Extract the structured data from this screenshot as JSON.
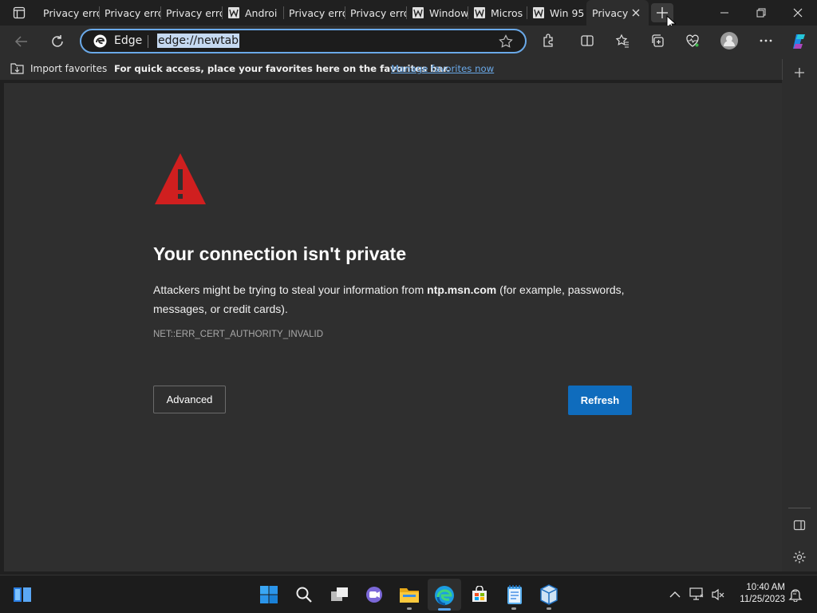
{
  "tabs": [
    {
      "label": "Privacy error",
      "icon": "page-icon"
    },
    {
      "label": "Privacy error",
      "icon": "page-icon"
    },
    {
      "label": "Privacy error",
      "icon": "page-icon"
    },
    {
      "label": "Androi",
      "icon": "wikipedia-icon"
    },
    {
      "label": "Privacy erro",
      "icon": "page-icon"
    },
    {
      "label": "Privacy erro",
      "icon": "page-icon"
    },
    {
      "label": "Window",
      "icon": "wikipedia-icon"
    },
    {
      "label": "Micros",
      "icon": "wikipedia-icon"
    },
    {
      "label": "Win 95",
      "icon": "wikipedia-icon"
    },
    {
      "label": "Privacy",
      "icon": "page-icon",
      "active": true
    }
  ],
  "address": {
    "brand": "Edge",
    "url": "edge://newtab"
  },
  "favorites_bar": {
    "import": "Import favorites",
    "message": "For quick access, place your favorites here on the favorites bar.",
    "manage_link": "Manage favorites now"
  },
  "error_page": {
    "heading": "Your connection isn't private",
    "body_prefix": "Attackers might be trying to steal your information from ",
    "host": "ntp.msn.com",
    "body_suffix": " (for example, passwords,",
    "body_line2": "messages, or credit cards).",
    "error_code": "NET::ERR_CERT_AUTHORITY_INVALID",
    "advanced_label": "Advanced",
    "refresh_label": "Refresh"
  },
  "taskbar": {
    "time": "10:40 AM",
    "date": "11/25/2023"
  },
  "colors": {
    "accent": "#0f6cbd",
    "warning": "#d01f1f",
    "link": "#6aa9e8",
    "selection": "#c5d9f1"
  }
}
